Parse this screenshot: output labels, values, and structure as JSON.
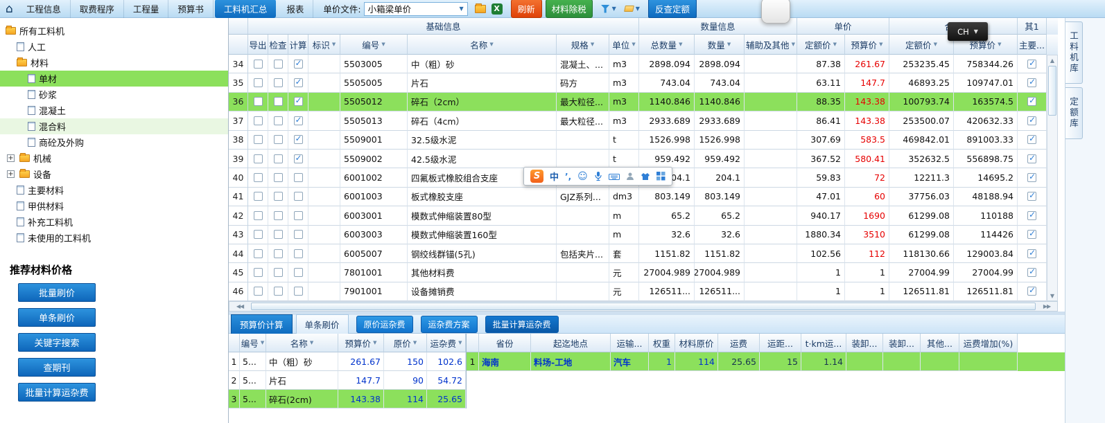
{
  "toolbar": {
    "tabs": [
      {
        "label": "工程信息",
        "active": false
      },
      {
        "label": "取费程序",
        "active": false
      },
      {
        "label": "工程量",
        "active": false
      },
      {
        "label": "预算书",
        "active": false
      },
      {
        "label": "工料机汇总",
        "active": true
      },
      {
        "label": "报表",
        "active": false
      }
    ],
    "unit_price_label": "单价文件:",
    "unit_price_value": "小箱梁单价",
    "refresh": "刷新",
    "tax": "材料除税",
    "reverse": "反查定额"
  },
  "lang_indicator": "CH",
  "ime_bar": {
    "logo": "S",
    "lang": "中"
  },
  "sidebar": {
    "tree": [
      {
        "label": "所有工料机",
        "icon": "folder",
        "level": 0
      },
      {
        "label": "人工",
        "icon": "doc",
        "level": 1
      },
      {
        "label": "材料",
        "icon": "folder",
        "level": 1
      },
      {
        "label": "单材",
        "icon": "doc",
        "level": 2,
        "selected": true
      },
      {
        "label": "砂浆",
        "icon": "doc",
        "level": 2
      },
      {
        "label": "混凝土",
        "icon": "doc",
        "level": 2
      },
      {
        "label": "混合料",
        "icon": "doc",
        "level": 2,
        "tint": true
      },
      {
        "label": "商砼及外购",
        "icon": "doc",
        "level": 2
      },
      {
        "label": "机械",
        "icon": "folder",
        "level": 1,
        "expander": "+"
      },
      {
        "label": "设备",
        "icon": "folder",
        "level": 1,
        "expander": "+"
      },
      {
        "label": "主要材料",
        "icon": "doc",
        "level": 1
      },
      {
        "label": "甲供材料",
        "icon": "doc",
        "level": 1
      },
      {
        "label": "补充工料机",
        "icon": "doc",
        "level": 1
      },
      {
        "label": "未使用的工料机",
        "icon": "doc",
        "level": 1
      }
    ],
    "recommend_title": "推荐材料价格",
    "price_buttons": [
      "批量刷价",
      "单条刷价",
      "关键字搜索",
      "查期刊",
      "批量计算运杂费"
    ]
  },
  "main_table": {
    "groups": [
      "基础信息",
      "数量信息",
      "单价",
      "合价",
      "其1"
    ],
    "columns": [
      "导出",
      "检查",
      "计算",
      "标识",
      "编号",
      "名称",
      "规格",
      "单位",
      "总数量",
      "数量",
      "辅助及其他",
      "定额价",
      "预算价",
      "定额价",
      "预算价",
      "主要..."
    ],
    "rows": [
      {
        "num": 34,
        "calc": true,
        "main": true,
        "code": "5503005",
        "name": "中（粗）砂",
        "spec": "混凝土、...",
        "unit": "m3",
        "total_qty": "2898.094",
        "qty": "2898.094",
        "de_price": "87.38",
        "budget_price": "261.67",
        "budget_red": true,
        "de_total": "253235.45",
        "budget_total": "758344.26"
      },
      {
        "num": 35,
        "calc": true,
        "main": true,
        "code": "5505005",
        "name": "片石",
        "spec": "码方",
        "unit": "m3",
        "total_qty": "743.04",
        "qty": "743.04",
        "de_price": "63.11",
        "budget_price": "147.7",
        "budget_red": true,
        "de_total": "46893.25",
        "budget_total": "109747.01"
      },
      {
        "num": 36,
        "calc": true,
        "main": true,
        "selected": true,
        "code": "5505012",
        "name": "碎石（2cm）",
        "spec": "最大粒径...",
        "unit": "m3",
        "total_qty": "1140.846",
        "qty": "1140.846",
        "de_price": "88.35",
        "budget_price": "143.38",
        "budget_red": true,
        "de_total": "100793.74",
        "budget_total": "163574.5"
      },
      {
        "num": 37,
        "calc": true,
        "main": true,
        "code": "5505013",
        "name": "碎石（4cm）",
        "spec": "最大粒径...",
        "unit": "m3",
        "total_qty": "2933.689",
        "qty": "2933.689",
        "de_price": "86.41",
        "budget_price": "143.38",
        "budget_red": true,
        "de_total": "253500.07",
        "budget_total": "420632.33"
      },
      {
        "num": 38,
        "calc": true,
        "main": true,
        "code": "5509001",
        "name": "32.5级水泥",
        "spec": "",
        "unit": "t",
        "total_qty": "1526.998",
        "qty": "1526.998",
        "de_price": "307.69",
        "budget_price": "583.5",
        "budget_red": true,
        "de_total": "469842.01",
        "budget_total": "891003.33"
      },
      {
        "num": 39,
        "calc": true,
        "main": true,
        "code": "5509002",
        "name": "42.5级水泥",
        "spec": "",
        "unit": "t",
        "total_qty": "959.492",
        "qty": "959.492",
        "de_price": "367.52",
        "budget_price": "580.41",
        "budget_red": true,
        "de_total": "352632.5",
        "budget_total": "556898.75"
      },
      {
        "num": 40,
        "calc": false,
        "main": true,
        "code": "6001002",
        "name": "四氟板式橡胶组合支座",
        "spec": "",
        "unit": "",
        "total_qty": "204.1",
        "qty": "204.1",
        "de_price": "59.83",
        "budget_price": "72",
        "budget_red": true,
        "de_total": "12211.3",
        "budget_total": "14695.2"
      },
      {
        "num": 41,
        "calc": false,
        "main": true,
        "code": "6001003",
        "name": "板式橡胶支座",
        "spec": "GJZ系列...",
        "unit": "dm3",
        "total_qty": "803.149",
        "qty": "803.149",
        "de_price": "47.01",
        "budget_price": "60",
        "budget_red": true,
        "de_total": "37756.03",
        "budget_total": "48188.94"
      },
      {
        "num": 42,
        "calc": false,
        "main": true,
        "code": "6003001",
        "name": "模数式伸缩装置80型",
        "spec": "",
        "unit": "m",
        "total_qty": "65.2",
        "qty": "65.2",
        "de_price": "940.17",
        "budget_price": "1690",
        "budget_red": true,
        "de_total": "61299.08",
        "budget_total": "110188"
      },
      {
        "num": 43,
        "calc": false,
        "main": true,
        "code": "6003003",
        "name": "模数式伸缩装置160型",
        "spec": "",
        "unit": "m",
        "total_qty": "32.6",
        "qty": "32.6",
        "de_price": "1880.34",
        "budget_price": "3510",
        "budget_red": true,
        "de_total": "61299.08",
        "budget_total": "114426"
      },
      {
        "num": 44,
        "calc": false,
        "main": true,
        "code": "6005007",
        "name": "钢绞线群锚(5孔)",
        "spec": "包括夹片...",
        "unit": "套",
        "total_qty": "1151.82",
        "qty": "1151.82",
        "de_price": "102.56",
        "budget_price": "112",
        "budget_red": true,
        "de_total": "118130.66",
        "budget_total": "129003.84"
      },
      {
        "num": 45,
        "calc": false,
        "main": true,
        "code": "7801001",
        "name": "其他材料费",
        "spec": "",
        "unit": "元",
        "total_qty": "27004.989",
        "qty": "27004.989",
        "de_price": "1",
        "budget_price": "1",
        "budget_red": false,
        "de_total": "27004.99",
        "budget_total": "27004.99"
      },
      {
        "num": 46,
        "calc": false,
        "main": true,
        "code": "7901001",
        "name": "设备摊销费",
        "spec": "",
        "unit": "元",
        "total_qty": "126511...",
        "qty": "126511...",
        "de_price": "1",
        "budget_price": "1",
        "budget_red": false,
        "de_total": "126511.81",
        "budget_total": "126511.81"
      }
    ]
  },
  "bottom_panel": {
    "tabs": [
      {
        "label": "预算价计算",
        "active": true
      },
      {
        "label": "单条刷价",
        "active": false
      }
    ],
    "buttons": [
      "原价运杂费",
      "运杂费方案",
      "批量计算运杂费"
    ],
    "price_table": {
      "columns": [
        "编号",
        "名称",
        "预算价",
        "原价",
        "运杂费"
      ],
      "rows": [
        {
          "num": "1",
          "code": "5...",
          "name": "中（粗）砂",
          "budget": "261.67",
          "orig": "150",
          "freight": "102.6"
        },
        {
          "num": "2",
          "code": "5...",
          "name": "片石",
          "budget": "147.7",
          "orig": "90",
          "freight": "54.72"
        },
        {
          "num": "3",
          "code": "5...",
          "name": "碎石(2cm)",
          "budget": "143.38",
          "orig": "114",
          "freight": "25.65",
          "selected": true
        }
      ]
    },
    "freight_table": {
      "columns": [
        "省份",
        "起迄地点",
        "运输...",
        "权重",
        "材料原价",
        "运费",
        "运距...",
        "t·km运...",
        "装卸...",
        "装卸...",
        "其他...",
        "运费增加(%)"
      ],
      "rows": [
        {
          "num": "1",
          "province": "海南",
          "route": "料场-工地",
          "transport": "汽车",
          "weight": "1",
          "material_price": "114",
          "freight": "25.65",
          "distance": "15",
          "tkm": "1.14",
          "load_a": "",
          "load_b": "",
          "other": "",
          "increase": ""
        }
      ]
    }
  },
  "right_tabs": [
    "工料机库",
    "定额库"
  ]
}
